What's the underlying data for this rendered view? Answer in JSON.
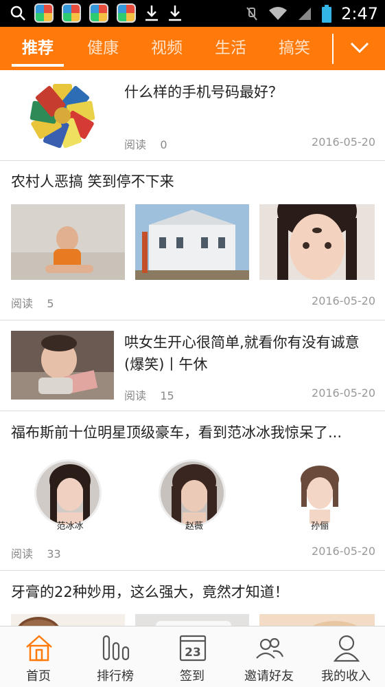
{
  "status_bar": {
    "time": "2:47",
    "icons": [
      "search-icon",
      "app-icon",
      "app-icon",
      "app-icon",
      "app-icon",
      "download-icon",
      "download-icon",
      "mute-icon",
      "wifi-icon",
      "signal-icon",
      "battery-icon"
    ]
  },
  "tabs": [
    {
      "label": "推荐",
      "active": true
    },
    {
      "label": "健康",
      "active": false
    },
    {
      "label": "视频",
      "active": false
    },
    {
      "label": "生活",
      "active": false
    },
    {
      "label": "搞笑",
      "active": false
    }
  ],
  "articles": [
    {
      "title": "什么样的手机号码最好？",
      "read_label": "阅读",
      "read_count": "0",
      "date": "2016-05-20"
    },
    {
      "title": "农村人恶搞  笑到停不下来",
      "read_label": "阅读",
      "read_count": "5",
      "date": "2016-05-20"
    },
    {
      "title": "哄女生开心很简单,就看你有没有诚意(爆笑)丨午休",
      "read_label": "阅读",
      "read_count": "15",
      "date": "2016-05-20"
    },
    {
      "title": "福布斯前十位明星顶级豪车，看到范冰冰我惊呆了...",
      "read_label": "阅读",
      "read_count": "33",
      "date": "2016-05-20",
      "people": [
        "范冰冰",
        "赵薇",
        "孙俪"
      ]
    },
    {
      "title": "牙膏的22种妙用，这么强大，竟然才知道！"
    }
  ],
  "bottom_nav": [
    {
      "label": "首页",
      "icon": "home-icon",
      "active": true
    },
    {
      "label": "排行榜",
      "icon": "ranking-icon",
      "active": false
    },
    {
      "label": "签到",
      "icon": "calendar-icon",
      "calendar_day": "23",
      "active": false
    },
    {
      "label": "邀请好友",
      "icon": "friends-icon",
      "active": false
    },
    {
      "label": "我的收入",
      "icon": "user-icon",
      "active": false
    }
  ],
  "colors": {
    "accent": "#ff7a0b",
    "status_bar": "#000000"
  }
}
